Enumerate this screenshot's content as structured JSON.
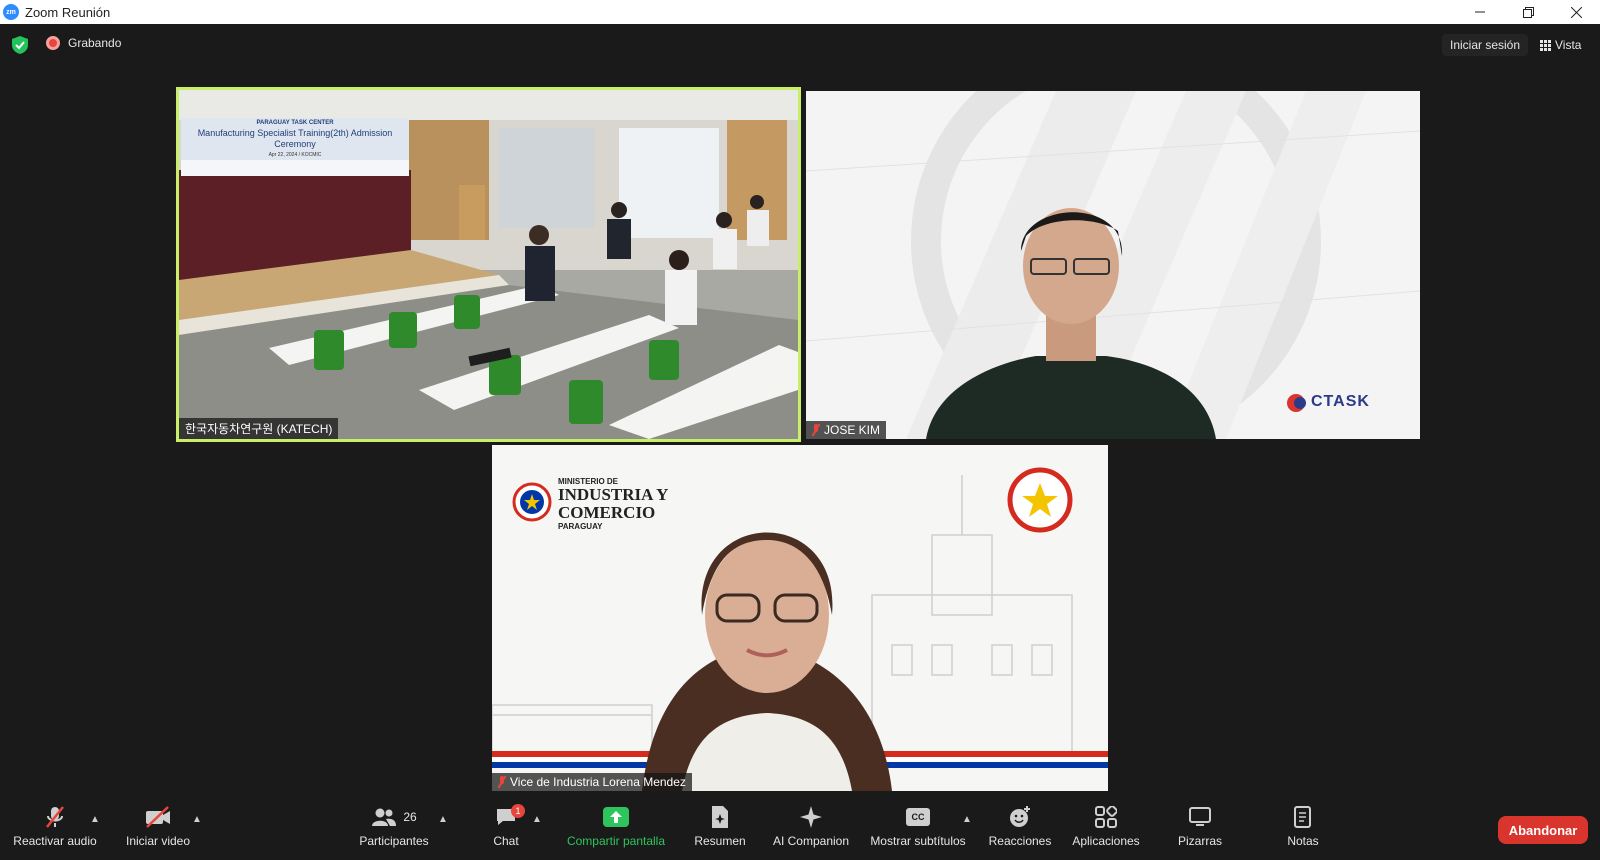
{
  "window": {
    "title": "Zoom Reunión",
    "logo_text": "zm"
  },
  "topbar": {
    "recording_label": "Grabando",
    "signin_label": "Iniciar sesión",
    "view_label": "Vista"
  },
  "tiles": [
    {
      "name": "한국자동차연구원 (KATECH)",
      "banner_org": "PARAGUAY TASK CENTER",
      "banner_title": "Manufacturing Specialist Training(2th) Admission Ceremony",
      "banner_date": "Apr 22, 2024 / KOCMIC",
      "active_speaker": true
    },
    {
      "name": "JOSE KIM",
      "logo_text": "CTASK"
    },
    {
      "name": "Vice de Industria Lorena Mendez",
      "ministry_line1": "MINISTERIO DE",
      "ministry_line2": "INDUSTRIA Y",
      "ministry_line3": "COMERCIO",
      "ministry_line4": "PARAGUAY"
    }
  ],
  "toolbar": {
    "audio_label": "Reactivar audio",
    "video_label": "Iniciar video",
    "participants_label": "Participantes",
    "participants_count": "26",
    "chat_label": "Chat",
    "chat_badge": "1",
    "share_label": "Compartir pantalla",
    "summary_label": "Resumen",
    "ai_label": "AI Companion",
    "captions_label": "Mostrar subtítulos",
    "captions_icon_text": "CC",
    "reactions_label": "Reacciones",
    "apps_label": "Aplicaciones",
    "whiteboards_label": "Pizarras",
    "notes_label": "Notas",
    "leave_label": "Abandonar"
  },
  "colors": {
    "active_speaker_border": "#c9ef6a",
    "share_green": "#2ec55c",
    "leave_red": "#d9352d",
    "muted_red": "#e8453c"
  }
}
